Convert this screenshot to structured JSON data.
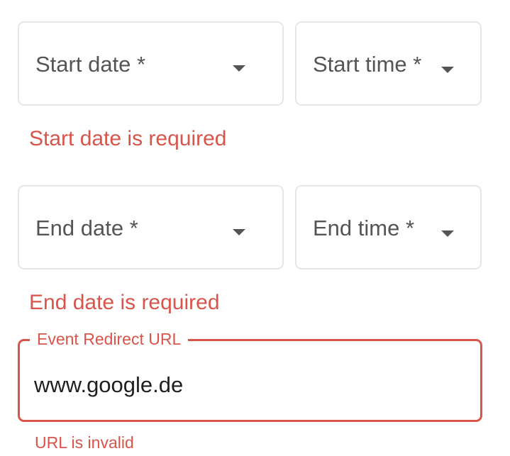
{
  "start": {
    "date_label": "Start date *",
    "time_label": "Start time *",
    "error": "Start date is required"
  },
  "end": {
    "date_label": "End date *",
    "time_label": "End time *",
    "error": "End date is required"
  },
  "redirect_url": {
    "label": "Event Redirect URL",
    "value": "www.google.de",
    "error": "URL is invalid"
  },
  "colors": {
    "error": "#d9544a",
    "border": "#e6e6e6",
    "label_text": "#555555",
    "input_text": "#1f1f1f"
  },
  "icons": {
    "dropdown": "caret-down-icon"
  }
}
